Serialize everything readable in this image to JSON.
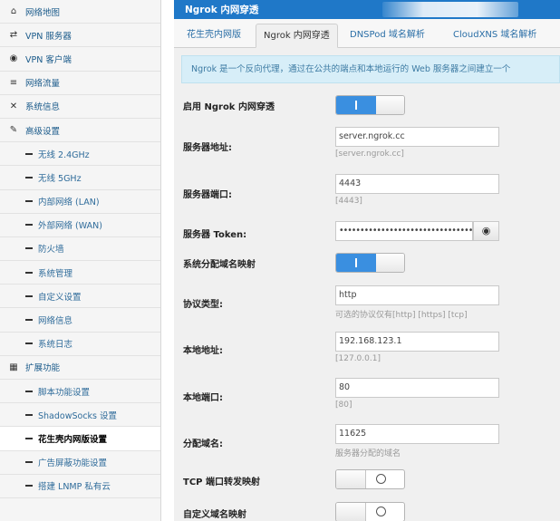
{
  "sidebar": {
    "items": [
      {
        "icon": "home-icon",
        "glyph": "⌂",
        "label": "网络地图",
        "sub": false
      },
      {
        "icon": "vpn-server-icon",
        "glyph": "⇄",
        "label": "VPN 服务器",
        "sub": false
      },
      {
        "icon": "globe-icon",
        "glyph": "◉",
        "label": "VPN 客户端",
        "sub": false
      },
      {
        "icon": "traffic-icon",
        "glyph": "≡",
        "label": "网络流量",
        "sub": false
      },
      {
        "icon": "shuffle-icon",
        "glyph": "✕",
        "label": "系统信息",
        "sub": false
      },
      {
        "icon": "wrench-icon",
        "glyph": "✎",
        "label": "高级设置",
        "sub": false
      },
      {
        "label": "无线 2.4GHz",
        "sub": true
      },
      {
        "label": "无线 5GHz",
        "sub": true
      },
      {
        "label": "内部网络 (LAN)",
        "sub": true
      },
      {
        "label": "外部网络 (WAN)",
        "sub": true
      },
      {
        "label": "防火墙",
        "sub": true
      },
      {
        "label": "系统管理",
        "sub": true
      },
      {
        "label": "自定义设置",
        "sub": true
      },
      {
        "label": "网络信息",
        "sub": true
      },
      {
        "label": "系统日志",
        "sub": true
      },
      {
        "icon": "grid-icon",
        "glyph": "▦",
        "label": "扩展功能",
        "sub": false
      },
      {
        "label": "脚本功能设置",
        "sub": true
      },
      {
        "label": "ShadowSocks 设置",
        "sub": true
      },
      {
        "label": "花生壳内网版设置",
        "sub": true,
        "active": true
      },
      {
        "label": "广告屏蔽功能设置",
        "sub": true
      },
      {
        "label": "搭建 LNMP 私有云",
        "sub": true
      }
    ]
  },
  "header": {
    "title": "Ngrok 内网穿透"
  },
  "tabs": [
    {
      "label": "花生壳内网版",
      "active": false
    },
    {
      "label": "Ngrok 内网穿透",
      "active": true
    },
    {
      "label": "DNSPod 域名解析",
      "active": false
    },
    {
      "label": "CloudXNS 域名解析",
      "active": false
    }
  ],
  "info_text": "Ngrok 是一个反向代理，通过在公共的端点和本地运行的 Web 服务器之间建立一个",
  "form": {
    "enable": {
      "label": "启用 Ngrok 内网穿透",
      "state": "on"
    },
    "server": {
      "label": "服务器地址:",
      "value": "server.ngrok.cc",
      "hint": "[server.ngrok.cc]"
    },
    "port": {
      "label": "服务器端口:",
      "value": "4443",
      "hint": "[4443]"
    },
    "token": {
      "label": "服务器 Token:",
      "value": "••••••••••••••••••••••••••••••••••",
      "eye_icon": "eye-icon"
    },
    "sys_domain": {
      "label": "系统分配域名映射",
      "state": "on"
    },
    "protocol": {
      "label": "协议类型:",
      "value": "http",
      "hint": "可选的协议仅有[http] [https] [tcp]"
    },
    "local_addr": {
      "label": "本地地址:",
      "value": "192.168.123.1",
      "hint": "[127.0.0.1]"
    },
    "local_port": {
      "label": "本地端口:",
      "value": "80",
      "hint": "[80]"
    },
    "subdomain": {
      "label": "分配域名:",
      "value": "11625",
      "hint": "服务器分配的域名"
    },
    "tcp_map": {
      "label": "TCP 端口转发映射",
      "state": "off"
    },
    "custom_domain": {
      "label": "自定义域名映射",
      "state": "off"
    }
  },
  "colors": {
    "header": "#1f78c8",
    "toggle_on": "#3a8fe0",
    "info_bg": "#d7eef8",
    "link": "#2a6ea6"
  }
}
